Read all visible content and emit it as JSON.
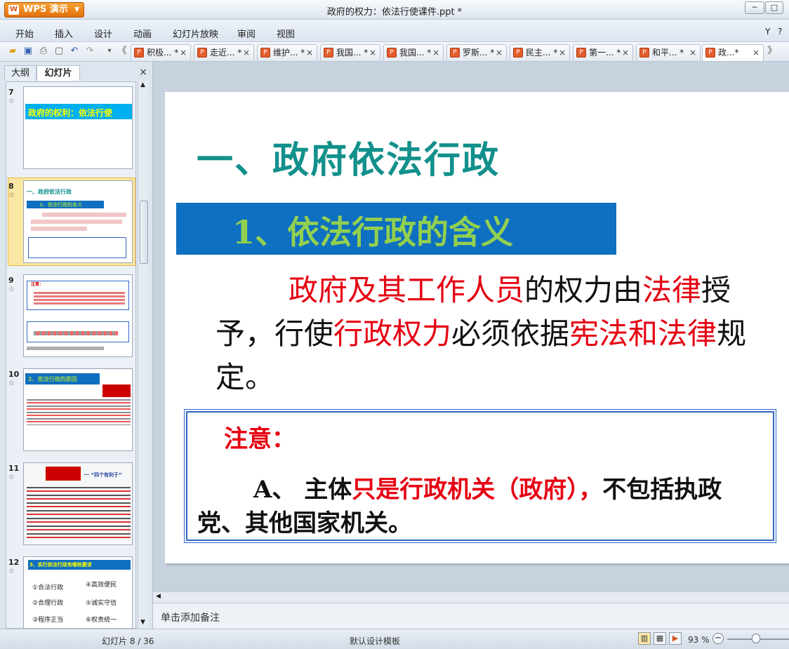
{
  "app": {
    "name": "WPS 演示",
    "window_title": "政府的权力：依法行使课件.ppt *"
  },
  "menu": [
    "开始",
    "插入",
    "设计",
    "动画",
    "幻灯片放映",
    "审阅",
    "视图"
  ],
  "tabs": [
    {
      "label": "积极... *"
    },
    {
      "label": "走近... *"
    },
    {
      "label": "维护... *"
    },
    {
      "label": "我国... *"
    },
    {
      "label": "我国... *"
    },
    {
      "label": "罗斯... *"
    },
    {
      "label": "民主... *"
    },
    {
      "label": "第一... *"
    },
    {
      "label": "和平... *"
    },
    {
      "label": "政...*"
    }
  ],
  "left_panel": {
    "tab_outline": "大纲",
    "tab_slides": "幻灯片",
    "close": "×"
  },
  "thumbnails": [
    {
      "num": "7",
      "title": "政府的权利：依法行使"
    },
    {
      "num": "8",
      "title": "一、政府依法行政",
      "sub": "1、依法行政的含义"
    },
    {
      "num": "9",
      "title": "注意："
    },
    {
      "num": "10",
      "title": "2、依法行政的原因"
    },
    {
      "num": "11",
      "title": "一 “四个有利于”"
    },
    {
      "num": "12",
      "title": "3、实行依法行政有哪些要求",
      "items": [
        "①合法行政",
        "④高效便民",
        "②合理行政",
        "⑤诚实守信",
        "③程序正当",
        "⑥权责统一"
      ]
    }
  ],
  "slide": {
    "title": "一、政府依法行政",
    "band": "1、依法行政的含义",
    "body_parts": [
      {
        "text": "政府及其工作人员",
        "red": true
      },
      {
        "text": "的权力由",
        "red": false
      },
      {
        "text": "法律",
        "red": true
      },
      {
        "text": "授予，行使",
        "red": false
      },
      {
        "text": "行政权力",
        "red": true
      },
      {
        "text": "必须依据",
        "red": false
      },
      {
        "text": "宪法和法律",
        "red": true
      },
      {
        "text": "规定。",
        "red": false
      }
    ],
    "note_label": "注意：",
    "note_parts": [
      {
        "text": "A、 主体",
        "red": false
      },
      {
        "text": "只是行政机关（政府），",
        "red": true
      },
      {
        "text": "不包括执政党、其他国家机关。",
        "red": false
      }
    ]
  },
  "notes_placeholder": "单击添加备注",
  "status": {
    "slide_pos": "幻灯片 8 / 36",
    "template": "默认设计模板",
    "zoom": "93 %"
  }
}
